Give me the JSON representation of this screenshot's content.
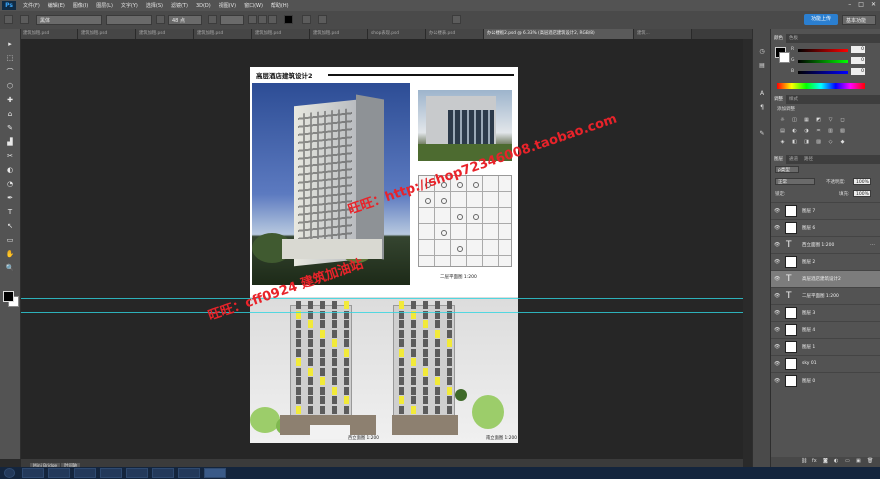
{
  "app": {
    "logo": "Ps"
  },
  "menu": [
    "文件(F)",
    "编辑(E)",
    "图像(I)",
    "图层(L)",
    "文字(Y)",
    "选择(S)",
    "滤镜(T)",
    "3D(D)",
    "视图(V)",
    "窗口(W)",
    "帮助(H)"
  ],
  "window_controls": [
    "–",
    "□",
    "✕"
  ],
  "options": {
    "font_family": "黑体",
    "font_size": "48 点",
    "cloud_button": "功能上传",
    "workspace": "基本功能"
  },
  "tabs": [
    {
      "label": "建筑加粗.psd"
    },
    {
      "label": "建筑加粗.psd"
    },
    {
      "label": "建筑加粗.psd"
    },
    {
      "label": "建筑加粗.psd"
    },
    {
      "label": "建筑加粗.psd"
    },
    {
      "label": "建筑加粗.psd"
    },
    {
      "label": "shop表现.psd"
    },
    {
      "label": "办公楼表.psd"
    },
    {
      "label": "办公楼板2.psd @ 6.33% (高层酒店建筑设计2, RGB/8)",
      "active": true
    },
    {
      "label": "建筑..."
    }
  ],
  "tools": [
    "▸",
    "⬚",
    "⌒",
    "⬡",
    "✚",
    "⌂",
    "✎",
    "▟",
    "✂",
    "◐",
    "◔",
    "✒",
    "T",
    "↖",
    "▭",
    "✋",
    "🔍"
  ],
  "document": {
    "title": "高层酒店建筑设计2",
    "plan_caption": "二层平面图 1:200",
    "elev_left_caption": "西立面图 1:200",
    "elev_right_caption": "南立面图 1:200"
  },
  "watermark": {
    "url": "旺旺：http://shop72346008.taobao.com",
    "qq": "旺旺：cff0924  建筑加油站"
  },
  "statusbar": {
    "tabs": [
      "Mini Bridge",
      "时间轴"
    ]
  },
  "colors": {
    "accent": "#2b7fd0",
    "guide": "#2fd5e0",
    "watermark": "#e8232a",
    "highlight_yellow": "#f2ea39"
  },
  "panel_color": {
    "tabs": [
      "颜色",
      "色板"
    ],
    "channels": [
      {
        "label": "R",
        "value": "0",
        "gradient": "linear-gradient(90deg,#000,#f00)"
      },
      {
        "label": "G",
        "value": "0",
        "gradient": "linear-gradient(90deg,#000,#0f0)"
      },
      {
        "label": "B",
        "value": "0",
        "gradient": "linear-gradient(90deg,#000,#00f)"
      }
    ]
  },
  "panel_adjust": {
    "tabs": [
      "调整",
      "样式"
    ],
    "subtitle": "添加调整"
  },
  "panel_layers": {
    "tabs": [
      "图层",
      "通道",
      "路径"
    ],
    "kind": "ρ类型",
    "blend": "正常",
    "opacity_label": "不透明度:",
    "opacity": "100%",
    "lock_label": "锁定:",
    "fill_label": "填充:",
    "fill": "100%",
    "layers": [
      {
        "name": "图层 7",
        "type": "image"
      },
      {
        "name": "图层 6",
        "type": "image"
      },
      {
        "name": "西立面图 1:200",
        "type": "text",
        "extra": "…"
      },
      {
        "name": "图层 2",
        "type": "image"
      },
      {
        "name": "高层酒店建筑设计2",
        "type": "text",
        "selected": true
      },
      {
        "name": "二层平面图 1:200",
        "type": "text"
      },
      {
        "name": "图层 3",
        "type": "image"
      },
      {
        "name": "图层 4",
        "type": "image"
      },
      {
        "name": "图层 1",
        "type": "image"
      },
      {
        "name": "sky 01",
        "type": "image"
      },
      {
        "name": "图层 0",
        "type": "image"
      }
    ],
    "footer_icons": [
      "link-icon",
      "fx-icon",
      "mask-icon",
      "adjustment-icon",
      "folder-icon",
      "new-layer-icon",
      "trash-icon"
    ]
  }
}
